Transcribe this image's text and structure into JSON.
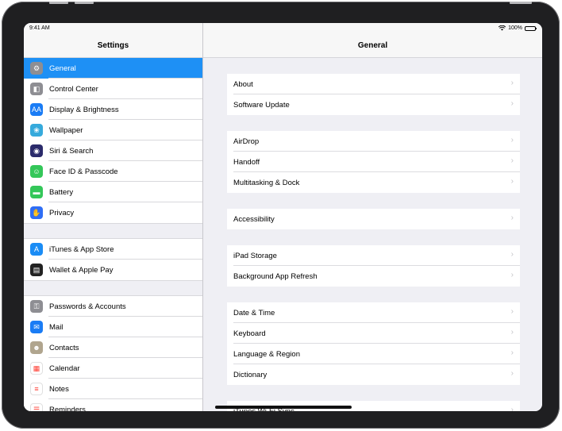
{
  "status_bar": {
    "time": "9:41 AM",
    "battery": "100%"
  },
  "sidebar": {
    "title": "Settings",
    "groups": [
      {
        "items": [
          {
            "label": "General",
            "icon": "gear-icon",
            "color": "#8e8e93",
            "selected": true
          },
          {
            "label": "Control Center",
            "icon": "toggles-icon",
            "color": "#8e8e93"
          },
          {
            "label": "Display & Brightness",
            "icon": "text-size-icon",
            "color": "#1a7cf5"
          },
          {
            "label": "Wallpaper",
            "icon": "flower-icon",
            "color": "#36aadc"
          },
          {
            "label": "Siri & Search",
            "icon": "siri-icon",
            "color": "#2b2b6b"
          },
          {
            "label": "Face ID & Passcode",
            "icon": "face-id-icon",
            "color": "#34c759"
          },
          {
            "label": "Battery",
            "icon": "battery-icon",
            "color": "#34c759"
          },
          {
            "label": "Privacy",
            "icon": "hand-icon",
            "color": "#2f6ef5"
          }
        ]
      },
      {
        "items": [
          {
            "label": "iTunes & App Store",
            "icon": "app-store-icon",
            "color": "#1a8cf5"
          },
          {
            "label": "Wallet & Apple Pay",
            "icon": "wallet-icon",
            "color": "#222222"
          }
        ]
      },
      {
        "items": [
          {
            "label": "Passwords & Accounts",
            "icon": "key-icon",
            "color": "#8e8e93"
          },
          {
            "label": "Mail",
            "icon": "mail-icon",
            "color": "#1a7cf5"
          },
          {
            "label": "Contacts",
            "icon": "contacts-icon",
            "color": "#b0a58e"
          },
          {
            "label": "Calendar",
            "icon": "calendar-icon",
            "color": "#ffffff"
          },
          {
            "label": "Notes",
            "icon": "notes-icon",
            "color": "#ffffff"
          },
          {
            "label": "Reminders",
            "icon": "reminders-icon",
            "color": "#ffffff"
          }
        ]
      }
    ]
  },
  "detail": {
    "title": "General",
    "groups": [
      {
        "items": [
          "About",
          "Software Update"
        ]
      },
      {
        "items": [
          "AirDrop",
          "Handoff",
          "Multitasking & Dock"
        ]
      },
      {
        "items": [
          "Accessibility"
        ]
      },
      {
        "items": [
          "iPad Storage",
          "Background App Refresh"
        ]
      },
      {
        "items": [
          "Date & Time",
          "Keyboard",
          "Language & Region",
          "Dictionary"
        ]
      },
      {
        "items": [
          "iTunes Wi-Fi Sync"
        ]
      }
    ]
  },
  "accent_color": "#1e90f5"
}
